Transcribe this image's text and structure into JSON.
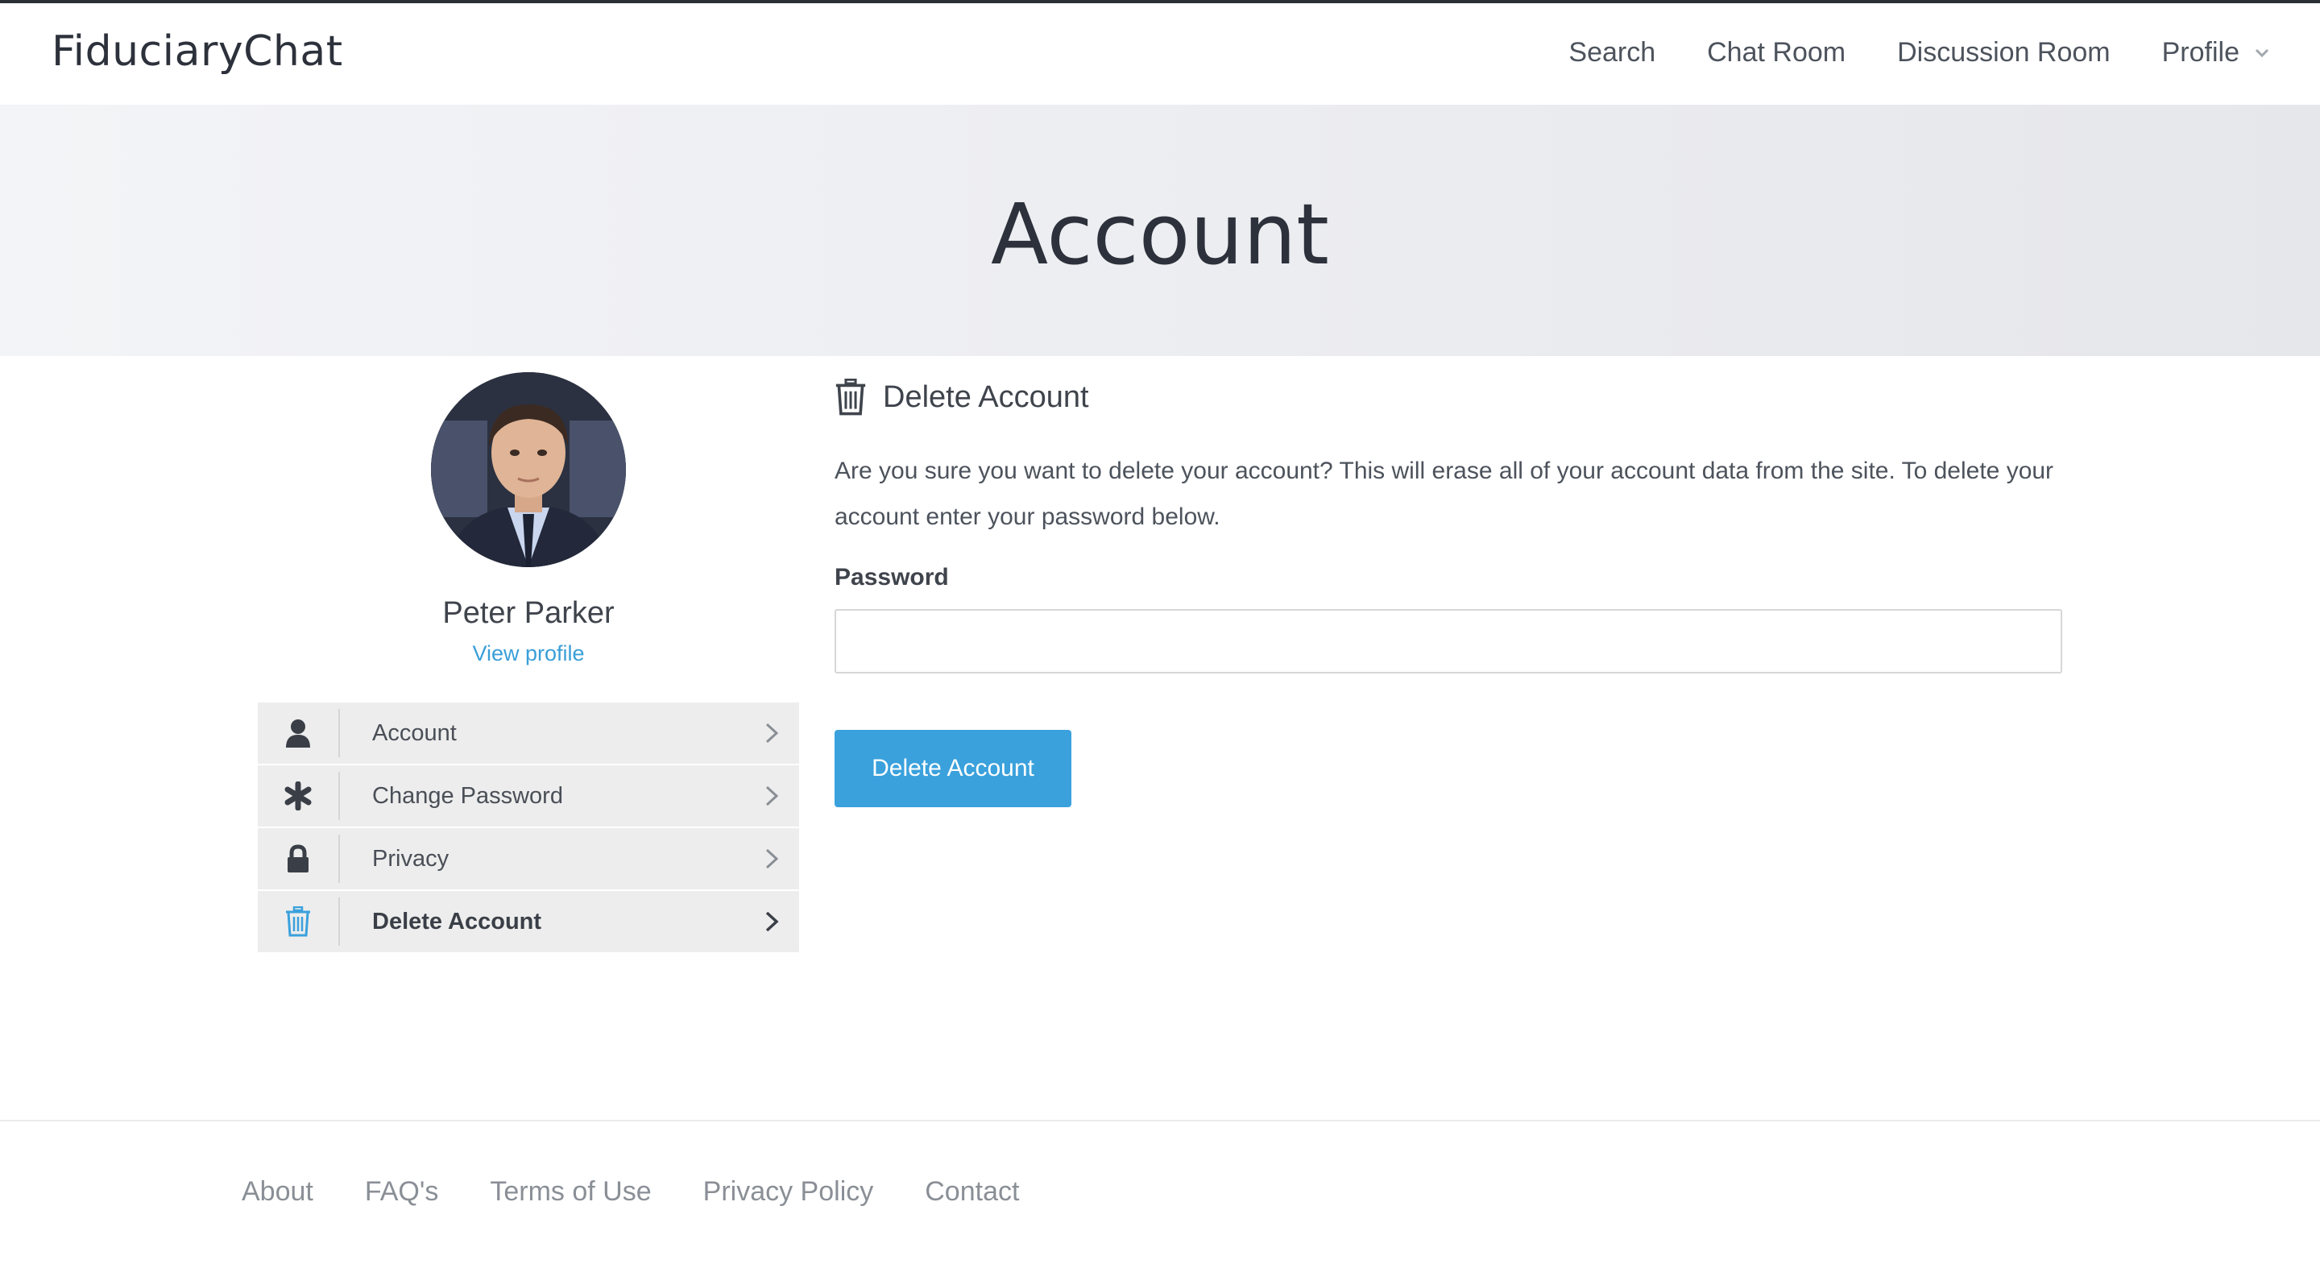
{
  "app": {
    "brand": "FiduciaryChat"
  },
  "nav": {
    "items": [
      {
        "label": "Search"
      },
      {
        "label": "Chat Room"
      },
      {
        "label": "Discussion Room"
      },
      {
        "label": "Profile"
      }
    ]
  },
  "hero": {
    "title": "Account"
  },
  "user": {
    "name": "Peter Parker",
    "view_profile": "View profile"
  },
  "sidebar": {
    "items": [
      {
        "label": "Account",
        "icon": "user-icon"
      },
      {
        "label": "Change Password",
        "icon": "asterisk-icon"
      },
      {
        "label": "Privacy",
        "icon": "lock-icon"
      },
      {
        "label": "Delete Account",
        "icon": "trash-icon",
        "active": true
      }
    ]
  },
  "main": {
    "section_title": "Delete Account",
    "description": "Are you sure you want to delete your account? This will erase all of your account data from the site. To delete your account enter your password below.",
    "password_label": "Password",
    "password_value": "",
    "submit_label": "Delete Account"
  },
  "footer": {
    "links": [
      {
        "label": "About"
      },
      {
        "label": "FAQ's"
      },
      {
        "label": "Terms of Use"
      },
      {
        "label": "Privacy Policy"
      },
      {
        "label": "Contact"
      }
    ]
  },
  "colors": {
    "accent": "#3aa1dc",
    "text_dark": "#2c313b",
    "menu_bg": "#ededed"
  }
}
